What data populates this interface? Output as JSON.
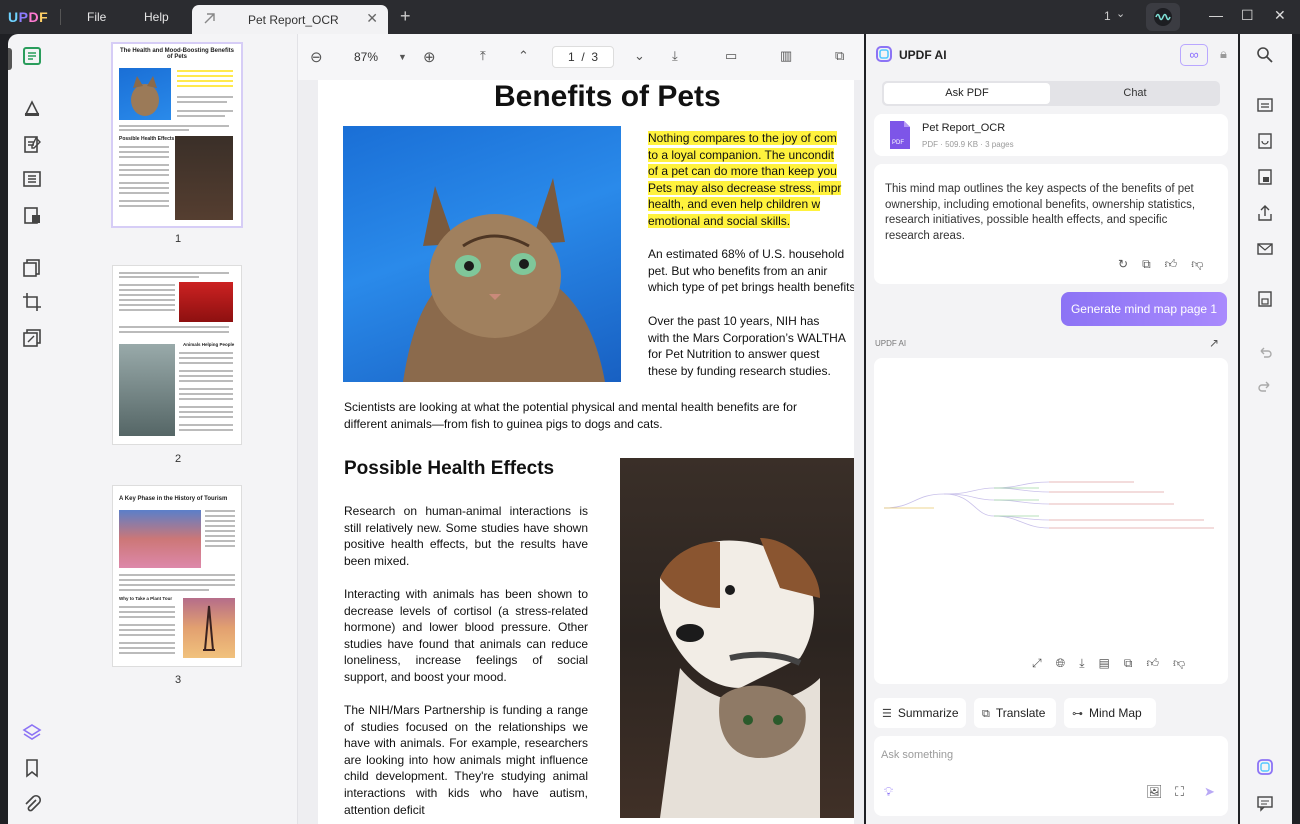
{
  "app": {
    "logo": "UPDF",
    "menu": [
      "File",
      "Help"
    ],
    "window_count": "1"
  },
  "tab": {
    "title": "Pet Report_OCR"
  },
  "toolbar": {
    "zoom": "87%",
    "page_current": "1",
    "page_total": "3",
    "page_sep": "/"
  },
  "thumbnails": [
    {
      "page": "1",
      "title": "The Health and Mood-Boosting Benefits of Pets"
    },
    {
      "page": "2"
    },
    {
      "page": "3",
      "title": "A Key Phase in the History of Tourism"
    }
  ],
  "thumb_text": {
    "p1_section": "Possible Health Effects",
    "p2_section": "Animals Helping People",
    "p3_section": "Why to Take a Plant Tour"
  },
  "document": {
    "title": "Benefits of Pets",
    "highlight_lines": [
      "Nothing compares to the joy of com",
      "to a loyal companion. The uncondit",
      "of a pet can do more than keep you",
      "Pets may also decrease stress, impr",
      "health, and even help children w",
      "emotional and social skills."
    ],
    "p2_lines": [
      "An estimated 68% of U.S. household",
      "pet. But who benefits from an anir",
      "which type of pet brings health benefits?"
    ],
    "p3_lines": [
      "Over the past 10 years, NIH has",
      "with the Mars Corporation’s WALTHA",
      "for Pet Nutrition to answer quest",
      "these by funding research studies."
    ],
    "p4": "Scientists are looking at what the potential physical and mental health benefits are for different animals—from fish to guinea pigs to dogs and cats.",
    "h2": "Possible Health Effects",
    "p5": "Research on human-animal interactions is still relatively new. Some studies have shown positive health effects, but the results have been mixed.",
    "p6": "Interacting with animals has been shown to decrease levels of cortisol (a stress-related hormone) and lower blood pressure. Other studies have found that animals can reduce loneliness, increase feelings of social support, and boost your mood.",
    "p7": "The NIH/Mars Partnership is funding a range of studies focused on the relationships we have with animals. For example, researchers are looking into how animals might influence child development. They're studying animal interactions with kids who have autism, attention deficit"
  },
  "ai": {
    "title": "UPDF AI",
    "tabs": {
      "ask": "Ask PDF",
      "chat": "Chat"
    },
    "file": {
      "name": "Pet Report_OCR",
      "meta": "PDF · 509.9 KB · 3 pages",
      "icon_label": "PDF"
    },
    "message": "This mind map outlines the key aspects of the benefits of pet ownership, including emotional benefits, ownership statistics, research initiatives, possible health effects, and specific research areas.",
    "user_prompt": "Generate mind map page 1",
    "responder": "UPDF AI",
    "chips": [
      "Summarize",
      "Translate",
      "Mind Map"
    ],
    "input_placeholder": "Ask something"
  },
  "colors": {
    "accent": "#8c73f5",
    "highlight": "#fff23d",
    "titlebar": "#2b2c30"
  }
}
